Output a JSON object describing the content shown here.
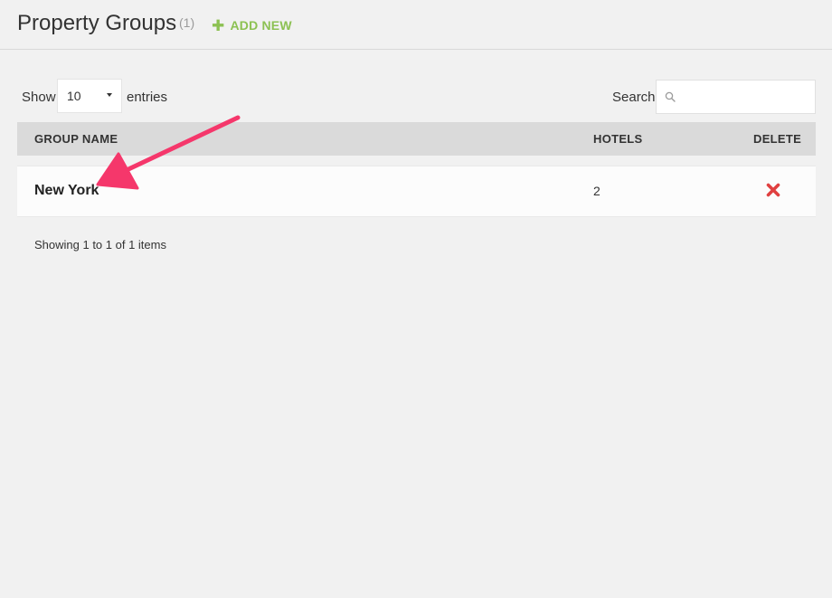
{
  "header": {
    "title": "Property Groups",
    "count": "(1)",
    "add_new_label": "ADD NEW"
  },
  "controls": {
    "show_label": "Show",
    "entries_value": "10",
    "entries_label": "entries",
    "search_label": "Search",
    "search_value": ""
  },
  "table": {
    "columns": [
      "GROUP NAME",
      "HOTELS",
      "DELETE"
    ],
    "rows": [
      {
        "group_name": "New York",
        "hotels": "2"
      }
    ]
  },
  "footer": {
    "info": "Showing 1 to 1 of 1 items"
  },
  "colors": {
    "accent": "#8cc152",
    "delete": "#e04040",
    "annotation_arrow": "#f5376b"
  }
}
